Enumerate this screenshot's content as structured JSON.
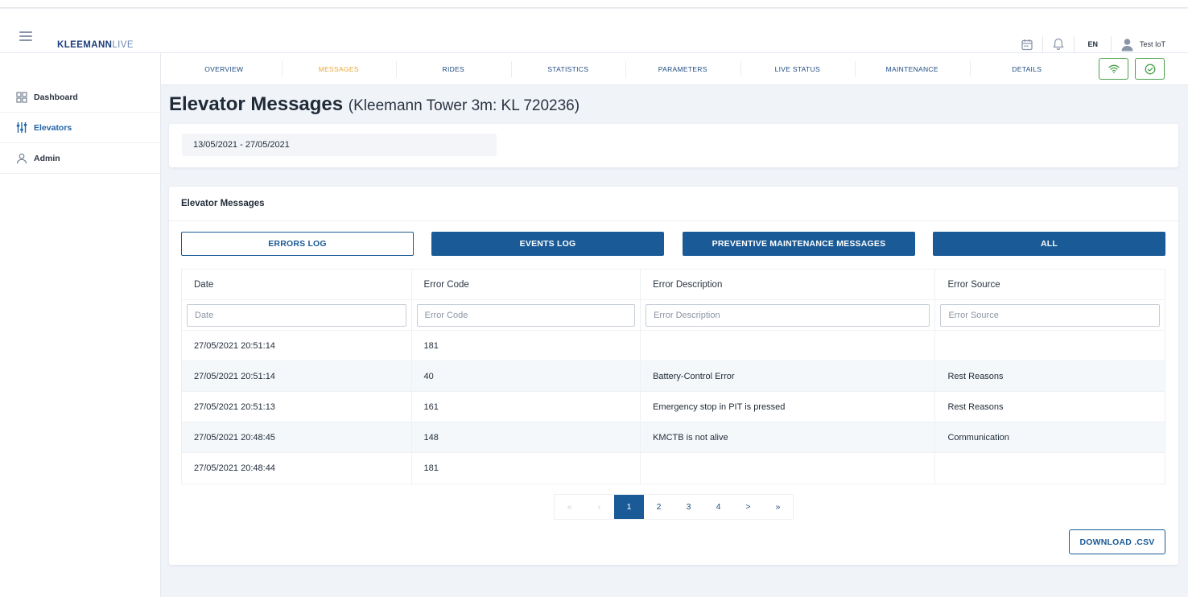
{
  "app": {
    "logo_bold": "KLEEMANN",
    "logo_light": "LIVE",
    "language": "EN",
    "user_name": "Test IoT"
  },
  "sidebar": {
    "items": [
      {
        "label": "Dashboard",
        "icon": "grid-icon",
        "active": false
      },
      {
        "label": "Elevators",
        "icon": "sliders-icon",
        "active": true
      },
      {
        "label": "Admin",
        "icon": "user-icon",
        "active": false
      }
    ]
  },
  "nav": {
    "tabs": [
      {
        "label": "OVERVIEW",
        "active": false
      },
      {
        "label": "MESSAGES",
        "active": true
      },
      {
        "label": "RIDES",
        "active": false
      },
      {
        "label": "STATISTICS",
        "active": false
      },
      {
        "label": "PARAMETERS",
        "active": false
      },
      {
        "label": "LIVE STATUS",
        "active": false
      },
      {
        "label": "MAINTENANCE",
        "active": false
      },
      {
        "label": "DETAILS",
        "active": false
      }
    ],
    "status_icons": [
      "wifi-icon",
      "check-circle-icon"
    ],
    "status_color": "#4aa04a"
  },
  "page": {
    "title": "Elevator Messages",
    "subtitle": "(Kleemann Tower 3m: KL 720236)"
  },
  "date_range": "13/05/2021 - 27/05/2021",
  "messages": {
    "card_title": "Elevator Messages",
    "buttons": [
      {
        "label": "ERRORS LOG",
        "style": "outline"
      },
      {
        "label": "EVENTS LOG",
        "style": "filled"
      },
      {
        "label": "PREVENTIVE MAINTENANCE MESSAGES",
        "style": "filled"
      },
      {
        "label": "ALL",
        "style": "filled"
      }
    ],
    "columns": [
      "Date",
      "Error Code",
      "Error Description",
      "Error Source"
    ],
    "filter_placeholders": [
      "Date",
      "Error Code",
      "Error Description",
      "Error Source"
    ],
    "rows": [
      [
        "27/05/2021 20:51:14",
        "181",
        "",
        ""
      ],
      [
        "27/05/2021 20:51:14",
        "40",
        "Battery-Control Error",
        "Rest Reasons"
      ],
      [
        "27/05/2021 20:51:13",
        "161",
        "Emergency stop in PIT is pressed",
        "Rest Reasons"
      ],
      [
        "27/05/2021 20:48:45",
        "148",
        "KMCTB is not alive",
        "Communication"
      ],
      [
        "27/05/2021 20:48:44",
        "181",
        "",
        ""
      ]
    ],
    "pagination": {
      "first": "«",
      "prev": "‹",
      "pages": [
        "1",
        "2",
        "3",
        "4"
      ],
      "current": "1",
      "next": ">",
      "last": "»"
    },
    "download_label": "DOWNLOAD .CSV"
  },
  "colors": {
    "primary": "#1a5a96",
    "active_tab": "#e8a93a",
    "background": "#f0f3f8"
  }
}
